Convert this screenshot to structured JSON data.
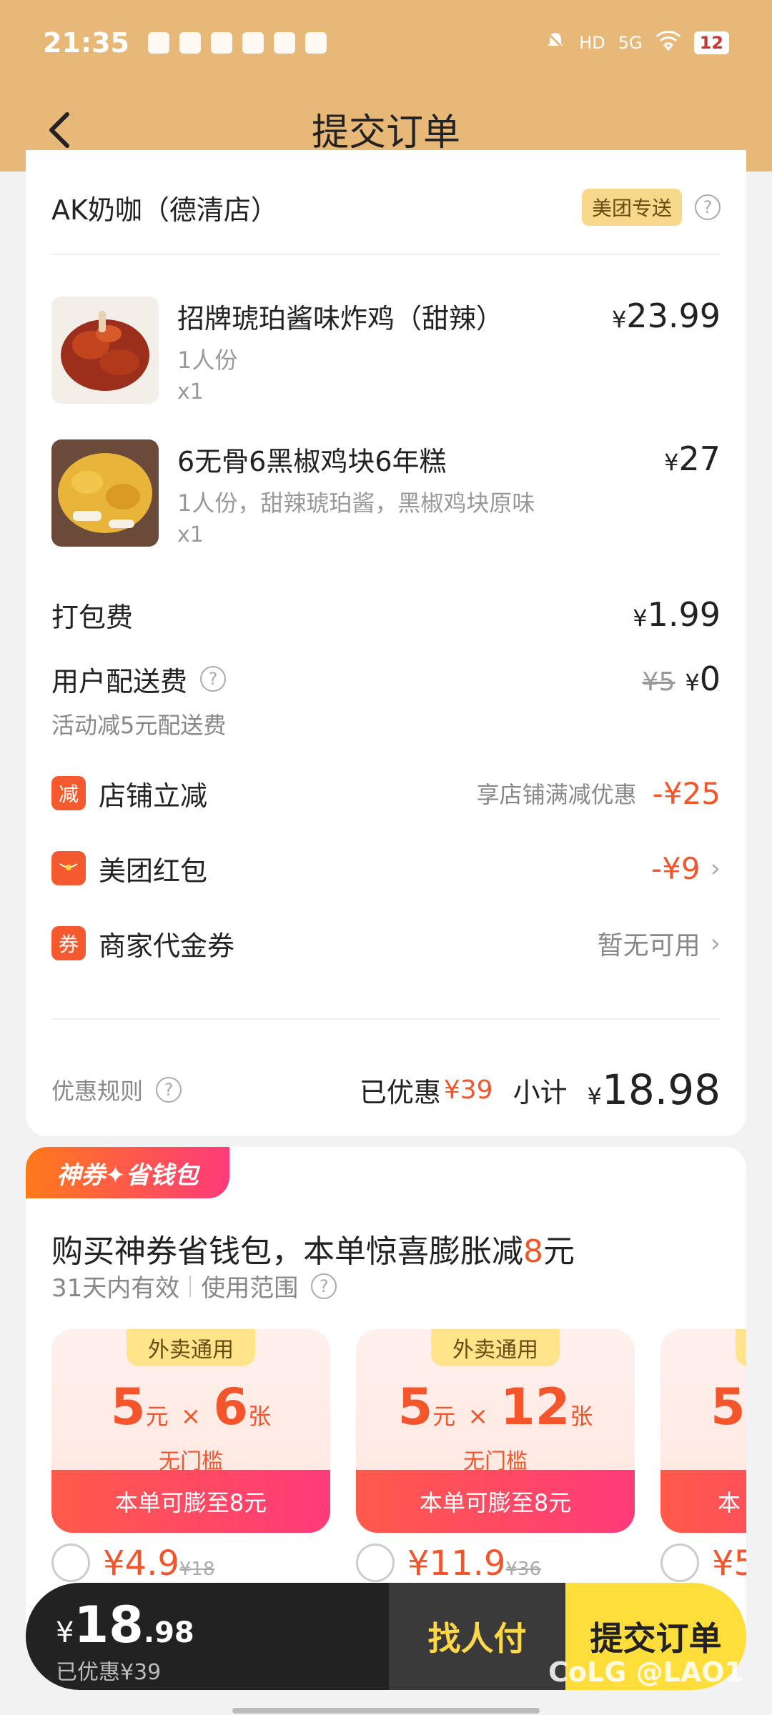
{
  "status": {
    "time": "21:35",
    "battery": "12",
    "net": "5G",
    "hd": "HD"
  },
  "nav": {
    "title": "提交订单"
  },
  "store": {
    "name": "AK奶咖（德清店）",
    "delivery_tag": "美团专送"
  },
  "items": [
    {
      "name": "招牌琥珀酱味炸鸡（甜辣）",
      "spec": "1人份",
      "qty": "x1",
      "price": "23.99"
    },
    {
      "name": "6无骨6黑椒鸡块6年糕",
      "spec": "1人份，甜辣琥珀酱，黑椒鸡块原味",
      "qty": "x1",
      "price": "27"
    }
  ],
  "fees": {
    "packing_label": "打包费",
    "packing_val": "1.99",
    "delivery_label": "用户配送费",
    "delivery_orig": "¥5",
    "delivery_val": "0",
    "delivery_note": "活动减5元配送费"
  },
  "discounts": {
    "store": {
      "badge": "减",
      "label": "店铺立减",
      "hint": "享店铺满减优惠",
      "value": "-¥25"
    },
    "redpacket": {
      "label": "美团红包",
      "value": "-¥9"
    },
    "voucher": {
      "badge": "券",
      "label": "商家代金券",
      "value": "暂无可用"
    }
  },
  "summary": {
    "rules": "优惠规则",
    "saved_label": "已优惠",
    "saved_val": "¥39",
    "subtotal_label": "小计",
    "subtotal_val": "18.98"
  },
  "promo": {
    "tag": "神券✦省钱包",
    "title_pre": "购买神券省钱包，本单惊喜膨胀减",
    "title_num": "8",
    "title_post": "元",
    "validity": "31天内有效",
    "scope": "使用范围",
    "coupons": [
      {
        "tag": "外卖通用",
        "amount": "5",
        "unit": "元",
        "count": "6",
        "count_unit": "张",
        "threshold": "无门槛",
        "bottom": "本单可膨至8元",
        "price": "¥4.9",
        "orig": "¥18"
      },
      {
        "tag": "外卖通用",
        "amount": "5",
        "unit": "元",
        "count": "12",
        "count_unit": "张",
        "threshold": "无门槛",
        "bottom": "本单可膨至8元",
        "price": "¥11.9",
        "orig": "¥36"
      },
      {
        "amount": "5",
        "bottom": "本",
        "price": "¥5"
      }
    ]
  },
  "bottom": {
    "yen": "¥",
    "total_int": "18",
    "total_dec": ".98",
    "saved": "已优惠¥39",
    "friend_pay": "找人付",
    "submit": "提交订单"
  },
  "watermark": "CoLG @LAO1"
}
